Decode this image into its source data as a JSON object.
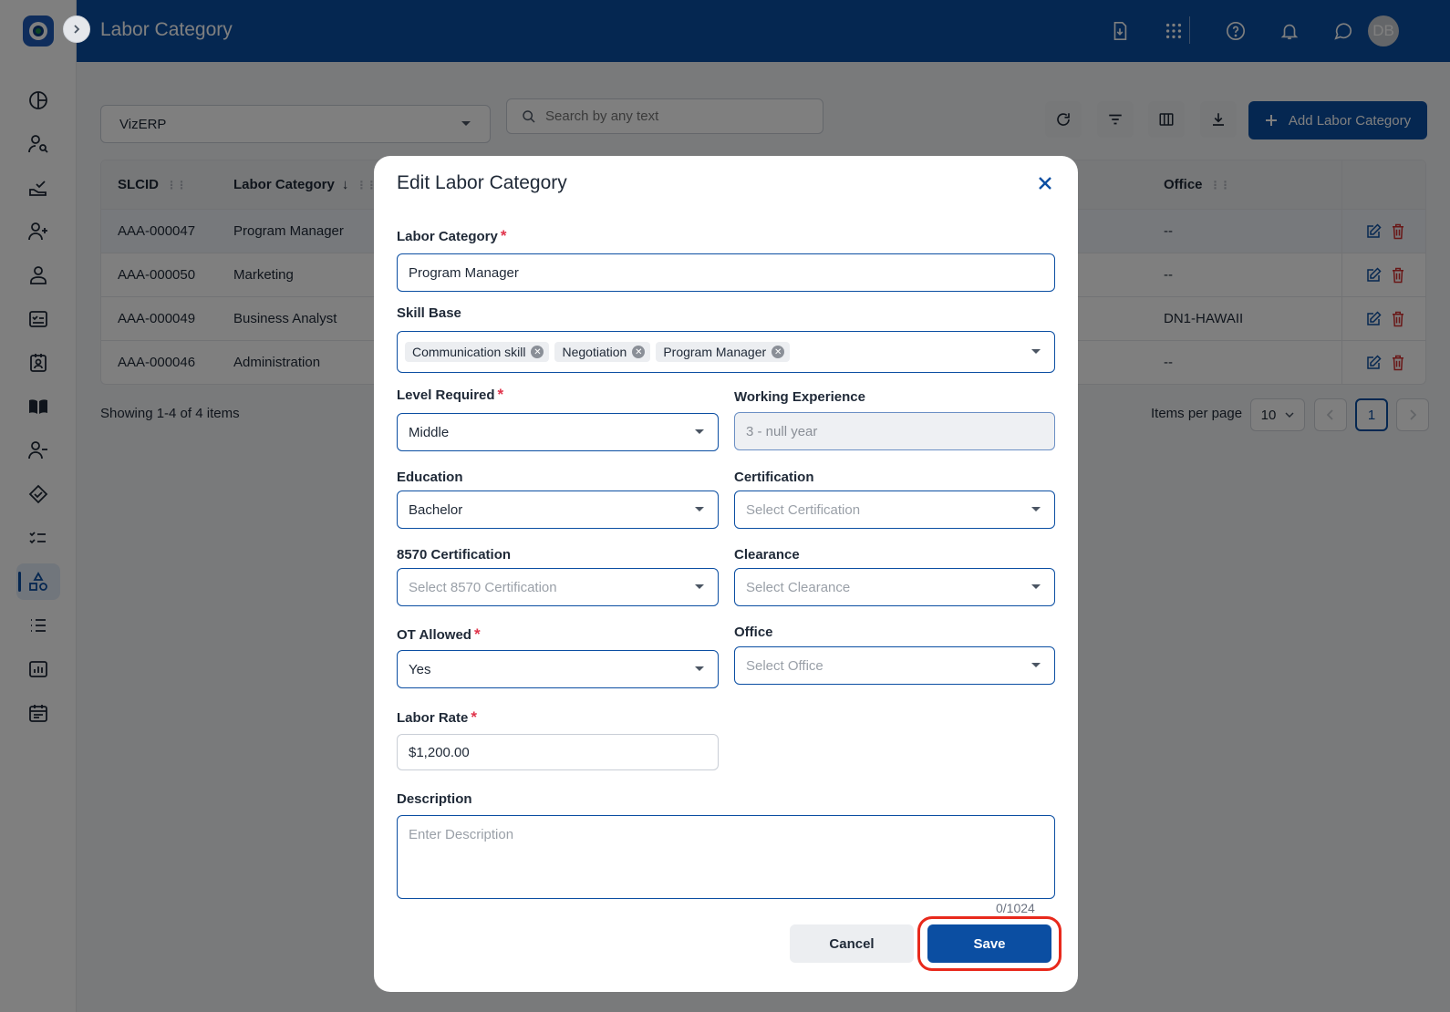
{
  "header": {
    "title": "Labor Category",
    "avatar_initials": "DB"
  },
  "sidebar": {
    "icons": [
      "dashboard-icon",
      "user-search-icon",
      "approval-icon",
      "add-user-icon",
      "person-icon",
      "checklist-icon",
      "badge-icon",
      "book-icon",
      "remove-user-icon",
      "handshake-icon",
      "todo-icon",
      "labor-category-icon",
      "list-icon",
      "report-icon",
      "calendar-icon"
    ],
    "active_index": 11
  },
  "toolbar": {
    "company_select": "VizERP",
    "search_placeholder": "Search by any text",
    "add_button": "Add Labor Category"
  },
  "table": {
    "columns": [
      "SLCID",
      "Labor Category",
      "Office"
    ],
    "rows": [
      {
        "slcid": "AAA-000047",
        "category": "Program Manager",
        "office": "--"
      },
      {
        "slcid": "AAA-000050",
        "category": "Marketing",
        "office": "--"
      },
      {
        "slcid": "AAA-000049",
        "category": "Business Analyst",
        "office": "DN1-HAWAII"
      },
      {
        "slcid": "AAA-000046",
        "category": "Administration",
        "office": "--"
      }
    ],
    "showing": "Showing 1-4 of 4 items",
    "items_per_page_label": "Items per page",
    "items_per_page": "10",
    "current_page": "1"
  },
  "modal": {
    "title": "Edit Labor Category",
    "labor_category": {
      "label": "Labor Category",
      "value": "Program Manager"
    },
    "skill_base": {
      "label": "Skill Base",
      "chips": [
        "Communication skill",
        "Negotiation",
        "Program Manager"
      ]
    },
    "level_required": {
      "label": "Level Required",
      "value": "Middle"
    },
    "working_experience": {
      "label": "Working Experience",
      "value": "3 - null year"
    },
    "education": {
      "label": "Education",
      "value": "Bachelor"
    },
    "certification": {
      "label": "Certification",
      "placeholder": "Select Certification"
    },
    "cert_8570": {
      "label": "8570 Certification",
      "placeholder": "Select 8570 Certification"
    },
    "clearance": {
      "label": "Clearance",
      "placeholder": "Select Clearance"
    },
    "ot_allowed": {
      "label": "OT Allowed",
      "value": "Yes"
    },
    "office": {
      "label": "Office",
      "placeholder": "Select Office"
    },
    "labor_rate": {
      "label": "Labor Rate",
      "value": "$1,200.00"
    },
    "description": {
      "label": "Description",
      "placeholder": "Enter Description",
      "counter": "0/1024"
    },
    "cancel": "Cancel",
    "save": "Save"
  },
  "colors": {
    "primary": "#0b4ea2",
    "required": "#e0344b",
    "delete": "#d32f2f",
    "highlight": "#e8291c"
  }
}
